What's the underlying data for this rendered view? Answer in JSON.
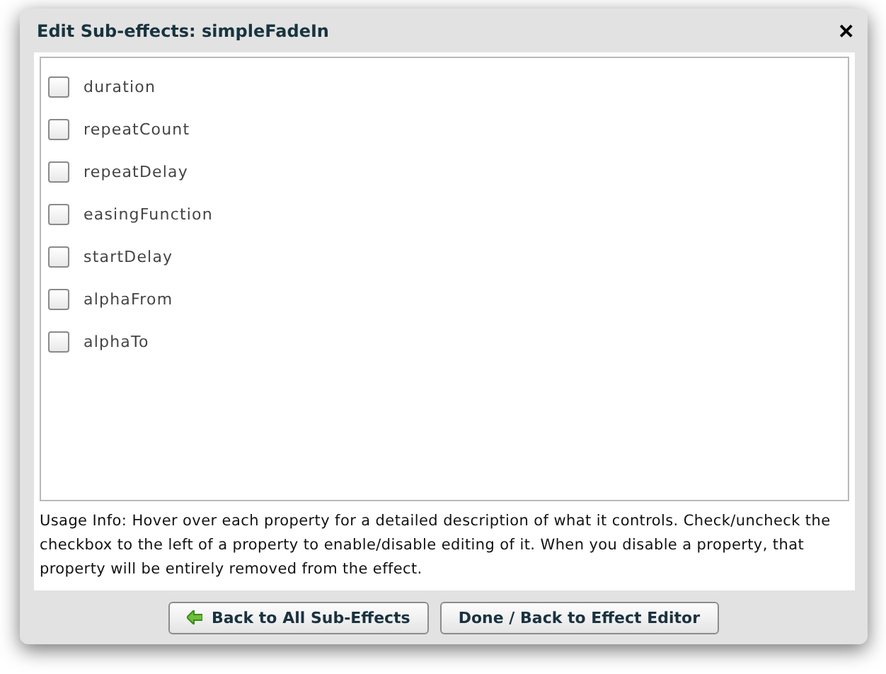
{
  "dialog": {
    "title": "Edit Sub-effects: simpleFadeIn",
    "close": "✕"
  },
  "properties": [
    {
      "label": "duration",
      "checked": false
    },
    {
      "label": "repeatCount",
      "checked": false
    },
    {
      "label": "repeatDelay",
      "checked": false
    },
    {
      "label": "easingFunction",
      "checked": false
    },
    {
      "label": "startDelay",
      "checked": false
    },
    {
      "label": "alphaFrom",
      "checked": false
    },
    {
      "label": "alphaTo",
      "checked": false
    }
  ],
  "usage_info": "Usage Info: Hover over each property for a detailed description of what it controls.  Check/uncheck the checkbox to the left of a property to enable/disable editing of it.  When you disable a property, that property will be entirely removed from the effect.",
  "buttons": [
    {
      "label": "Back to All Sub-Effects",
      "kind": "back"
    },
    {
      "label": "Done / Back to Effect Editor",
      "kind": "plain"
    }
  ]
}
